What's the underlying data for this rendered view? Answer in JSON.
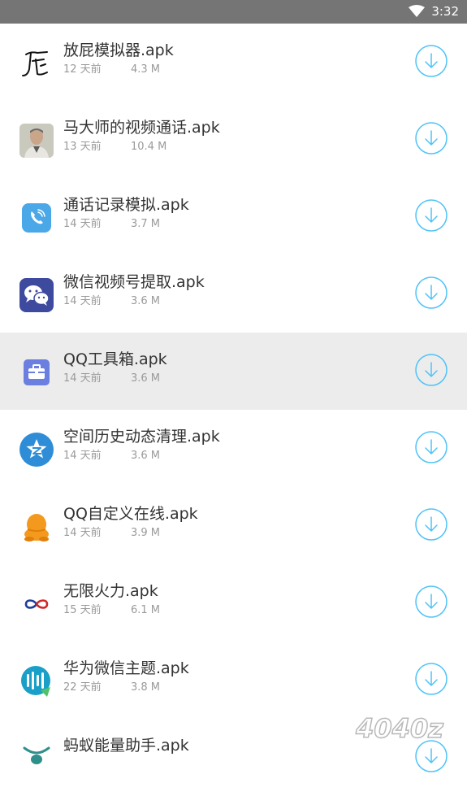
{
  "status_bar": {
    "time": "3:32"
  },
  "files": [
    {
      "name": "放屁模拟器.apk",
      "date": "12 天前",
      "size": "4.3 M",
      "icon": "fart-calligraphy-icon",
      "selected": false
    },
    {
      "name": "马大师的视频通话.apk",
      "date": "13 天前",
      "size": "10.4 M",
      "icon": "portrait-photo-icon",
      "selected": false
    },
    {
      "name": "通话记录模拟.apk",
      "date": "14 天前",
      "size": "3.7 M",
      "icon": "phone-call-icon",
      "selected": false
    },
    {
      "name": "微信视频号提取.apk",
      "date": "14 天前",
      "size": "3.6 M",
      "icon": "wechat-icon",
      "selected": false
    },
    {
      "name": "QQ工具箱.apk",
      "date": "14 天前",
      "size": "3.6 M",
      "icon": "toolbox-icon",
      "selected": true
    },
    {
      "name": "空间历史动态清理.apk",
      "date": "14 天前",
      "size": "3.6 M",
      "icon": "qzone-star-icon",
      "selected": false
    },
    {
      "name": "QQ自定义在线.apk",
      "date": "14 天前",
      "size": "3.9 M",
      "icon": "qq-penguin-icon",
      "selected": false
    },
    {
      "name": "无限火力.apk",
      "date": "15 天前",
      "size": "6.1 M",
      "icon": "infinity-icon",
      "selected": false
    },
    {
      "name": "华为微信主题.apk",
      "date": "22 天前",
      "size": "3.8 M",
      "icon": "bars-theme-icon",
      "selected": false
    },
    {
      "name": "蚂蚁能量助手.apk",
      "date": "",
      "size": "",
      "icon": "ant-icon",
      "selected": false
    }
  ],
  "colors": {
    "status_bar": "#757575",
    "accent": "#4fc3f7",
    "selected_row": "#ececec",
    "title_text": "#333333",
    "meta_text": "#9a9a9a"
  },
  "watermark": "4040z"
}
